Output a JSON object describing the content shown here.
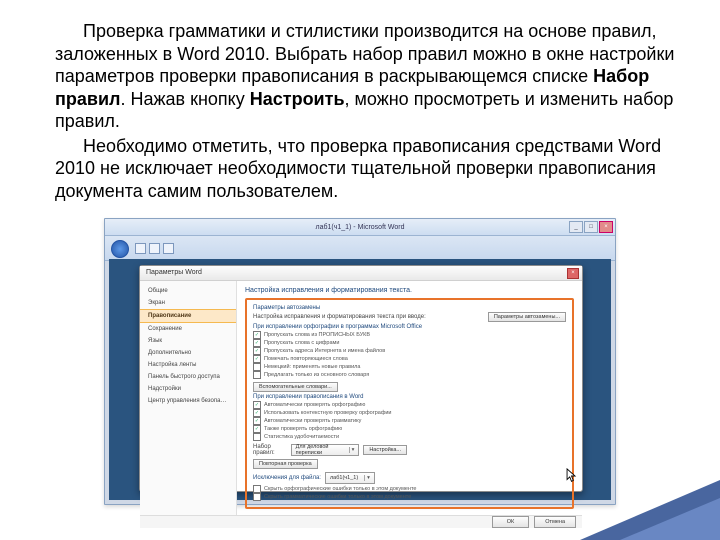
{
  "paragraph1_pre": "Проверка грамматики и стилистики производится на основе правил, заложенных в Word 2010. Выбрать набор правил можно в окне настройки параметров проверки правописания в раскрывающемся списке ",
  "paragraph1_bold1": "Набор правил",
  "paragraph1_mid": ". Нажав кнопку ",
  "paragraph1_bold2": "Настроить",
  "paragraph1_post": ", можно просмотреть и изменить набор правил.",
  "paragraph2": "Необходимо отметить, что проверка правописания средствами Word 2010 не исключает необходимости тщательной проверки правописания документа самим пользователем.",
  "word_window": {
    "app_title": "лаб1(ч1_1) - Microsoft Word",
    "win_min": "_",
    "win_max": "□",
    "win_close": "×"
  },
  "dialog": {
    "title": "Параметры Word",
    "close": "×",
    "sidebar": {
      "items": [
        "Общие",
        "Экран",
        "Правописание",
        "Сохранение",
        "Язык",
        "Дополнительно",
        "Настройка ленты",
        "Панель быстрого доступа",
        "Надстройки",
        "Центр управления безопасностью"
      ],
      "active_index": 2
    },
    "heading": "Настройка исправления и форматирования текста.",
    "autocorrect": {
      "title": "Параметры автозамены",
      "desc": "Настройка исправления и форматирования текста при вводе:",
      "button": "Параметры автозамены..."
    },
    "spelling_office": {
      "title": "При исправлении орфографии в программах Microsoft Office",
      "items": [
        {
          "label": "Пропускать слова из ПРОПИСНЫХ БУКВ",
          "checked": true
        },
        {
          "label": "Пропускать слова с цифрами",
          "checked": true
        },
        {
          "label": "Пропускать адреса Интернета и имена файлов",
          "checked": true
        },
        {
          "label": "Помечать повторяющиеся слова",
          "checked": true
        },
        {
          "label": "Немецкий: применять новые правила",
          "checked": false
        },
        {
          "label": "Предлагать только из основного словаря",
          "checked": false
        }
      ],
      "dict_button": "Вспомогательные словари..."
    },
    "spelling_word": {
      "title": "При исправлении правописания в Word",
      "items": [
        {
          "label": "Автоматически проверять орфографию",
          "checked": true
        },
        {
          "label": "Использовать контекстную проверку орфографии",
          "checked": true
        },
        {
          "label": "Автоматически проверять грамматику",
          "checked": true
        },
        {
          "label": "Также проверять орфографию",
          "checked": true
        },
        {
          "label": "Статистика удобочитаемости",
          "checked": false
        }
      ],
      "rules_label": "Набор правил:",
      "rules_value": "Для деловой переписки",
      "settings_button": "Настройка...",
      "recheck_button": "Повторная проверка"
    },
    "exceptions": {
      "title": "Исключения для файла:",
      "file": "лаб1(ч1_1)",
      "items": [
        {
          "label": "Скрыть орфографические ошибки только в этом документе",
          "checked": false
        },
        {
          "label": "Скрыть грамматические ошибки только в этом документе",
          "checked": false
        }
      ]
    },
    "footer": {
      "ok": "ОК",
      "cancel": "Отмена"
    }
  }
}
